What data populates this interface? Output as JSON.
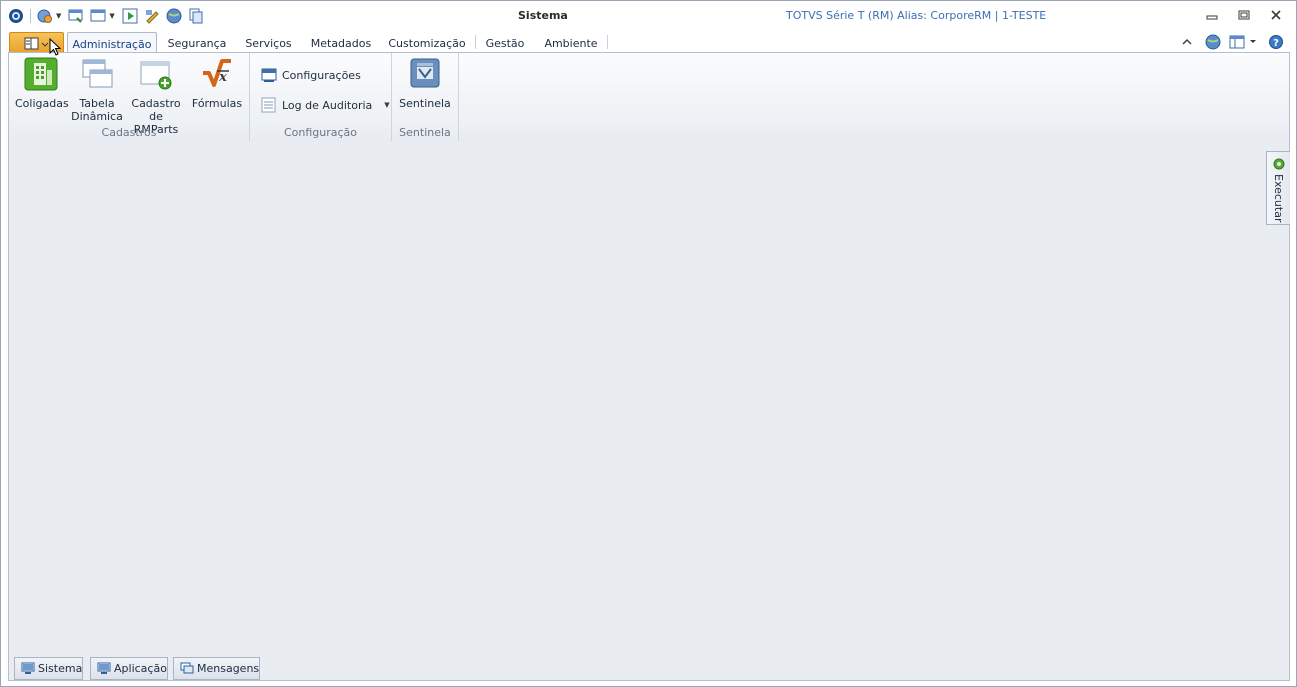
{
  "window": {
    "title": "Sistema",
    "alias_info": "TOTVS Série T  (RM) Alias: CorporeRM | 1-TESTE"
  },
  "quick_access": [
    "app-logo-icon",
    "globe-gear-icon",
    "screen-arrow-icon",
    "window-icon",
    "play-icon",
    "pencil-icon",
    "globe-icon",
    "copy-icon"
  ],
  "tabs": [
    {
      "label": "Administração",
      "active": true
    },
    {
      "label": "Segurança"
    },
    {
      "label": "Serviços"
    },
    {
      "label": "Metadados"
    },
    {
      "label": "Customização"
    },
    {
      "label": "Gestão"
    },
    {
      "label": "Ambiente"
    }
  ],
  "ribbon": {
    "cadastros": {
      "label": "Cadastros",
      "coligadas": "Coligadas",
      "tabela_dinamica": [
        "Tabela",
        "Dinâmica"
      ],
      "cadastro_rmparts": [
        "Cadastro",
        "de RMParts"
      ],
      "formulas": "Fórmulas"
    },
    "configuracao": {
      "label": "Configuração",
      "configuracoes": "Configurações",
      "log_auditoria": "Log de Auditoria"
    },
    "sentinela": {
      "label": "Sentinela",
      "sentinela_btn": "Sentinela"
    }
  },
  "side_panel": {
    "executar": "Executar"
  },
  "bottom_tabs": {
    "sistema": "Sistema",
    "aplicacao": "Aplicação",
    "mensagens": "Mensagens"
  },
  "colors": {
    "accent": "#e9a12b",
    "alias_text": "#3c6fb3",
    "content_bg": "#e9ecf1"
  }
}
